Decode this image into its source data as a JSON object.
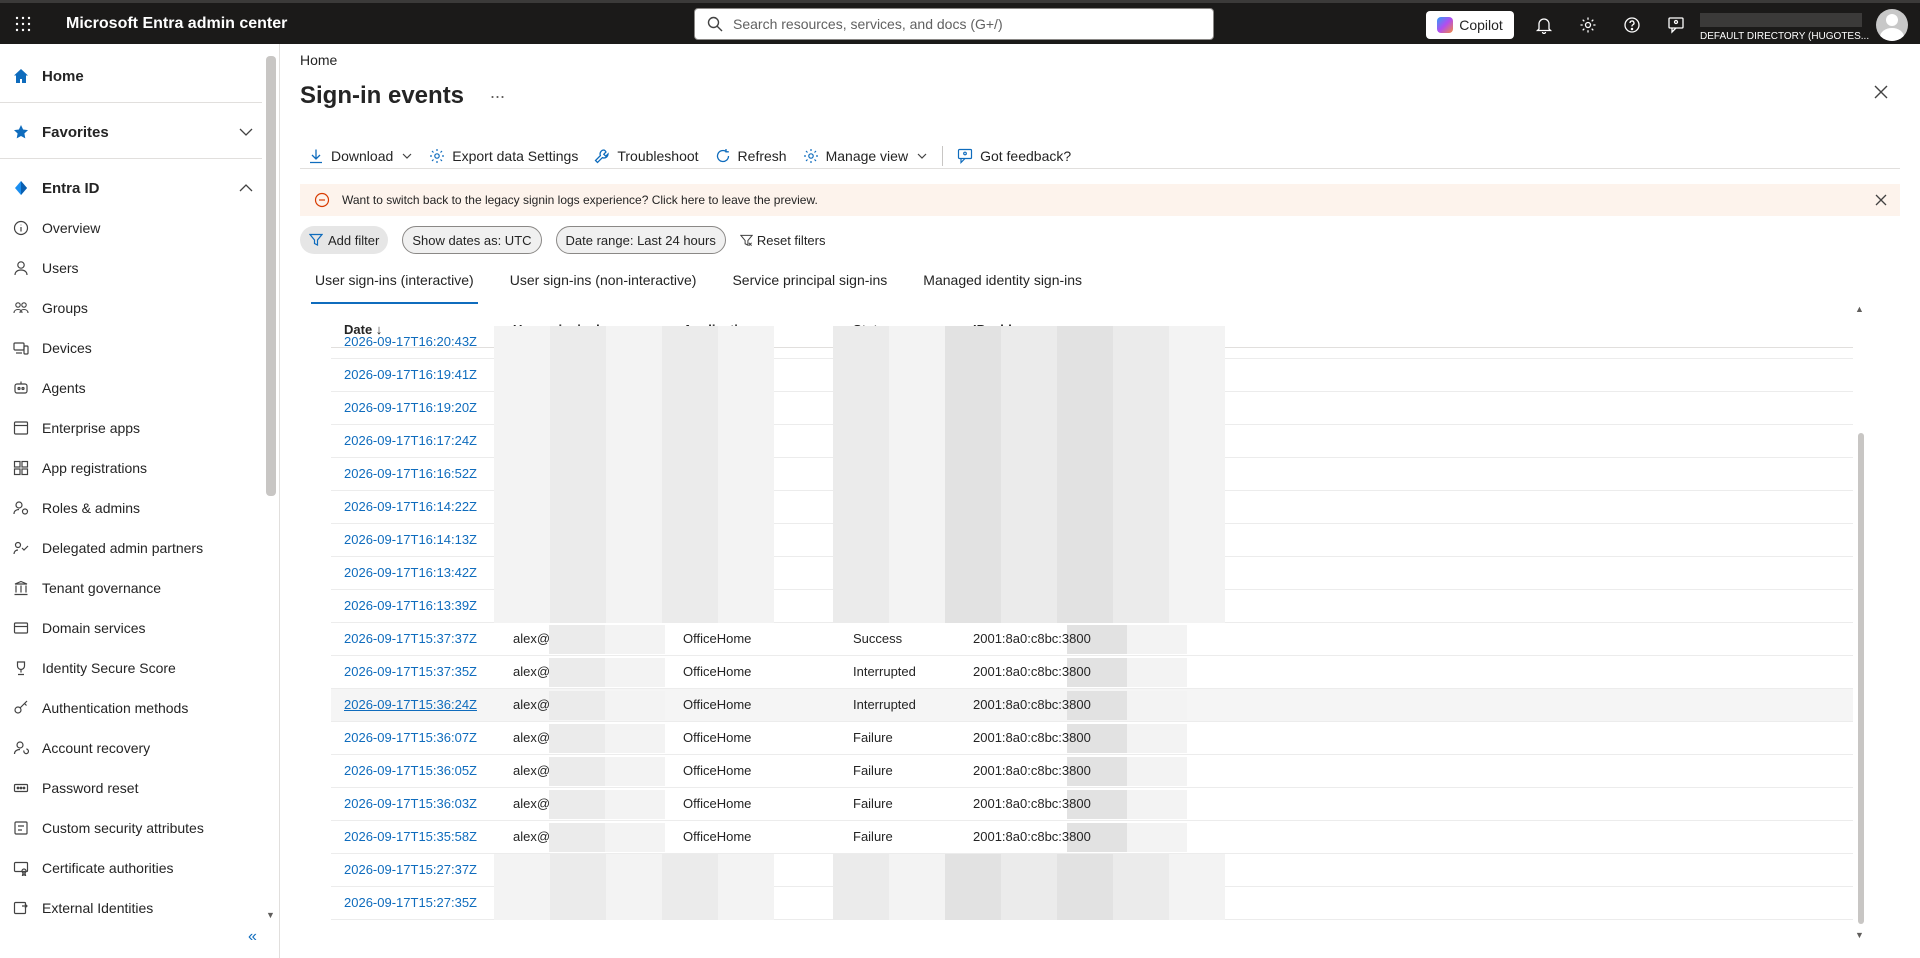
{
  "topbar": {
    "app_title": "Microsoft Entra admin center",
    "search_placeholder": "Search resources, services, and docs (G+/)",
    "copilot_label": "Copilot",
    "account_directory": "DEFAULT DIRECTORY (HUGOTES..."
  },
  "sidebar": {
    "home": "Home",
    "favorites": "Favorites",
    "entra_id": "Entra ID",
    "items": [
      "Overview",
      "Users",
      "Groups",
      "Devices",
      "Agents",
      "Enterprise apps",
      "App registrations",
      "Roles & admins",
      "Delegated admin partners",
      "Tenant governance",
      "Domain services",
      "Identity Secure Score",
      "Authentication methods",
      "Account recovery",
      "Password reset",
      "Custom security attributes",
      "Certificate authorities",
      "External Identities"
    ]
  },
  "main": {
    "breadcrumb": "Home",
    "title": "Sign-in events",
    "more": "...",
    "toolbar": {
      "download": "Download",
      "export": "Export data Settings",
      "troubleshoot": "Troubleshoot",
      "refresh": "Refresh",
      "manage_view": "Manage view",
      "feedback": "Got feedback?"
    },
    "banner": "Want to switch back to the legacy signin logs experience? Click here to leave the preview.",
    "filters": {
      "add_filter": "Add filter",
      "show_dates": "Show dates as: UTC",
      "date_range": "Date range: Last 24 hours",
      "reset": "Reset filters"
    },
    "tabs": [
      "User sign-ins (interactive)",
      "User sign-ins (non-interactive)",
      "Service principal sign-ins",
      "Managed identity sign-ins"
    ],
    "table": {
      "columns": [
        "Date ↓",
        "User principal name",
        "Application",
        "Status",
        "IP address"
      ],
      "rows": [
        {
          "date": "2026-09-17T16:20:43Z",
          "user": "",
          "app": "",
          "status": "",
          "ip": ""
        },
        {
          "date": "2026-09-17T16:19:41Z",
          "user": "",
          "app": "",
          "status": "",
          "ip": ""
        },
        {
          "date": "2026-09-17T16:19:20Z",
          "user": "",
          "app": "",
          "status": "",
          "ip": ""
        },
        {
          "date": "2026-09-17T16:17:24Z",
          "user": "",
          "app": "",
          "status": "",
          "ip": ""
        },
        {
          "date": "2026-09-17T16:16:52Z",
          "user": "",
          "app": "",
          "status": "",
          "ip": ""
        },
        {
          "date": "2026-09-17T16:14:22Z",
          "user": "",
          "app": "",
          "status": "",
          "ip": ""
        },
        {
          "date": "2026-09-17T16:14:13Z",
          "user": "",
          "app": "",
          "status": "",
          "ip": ""
        },
        {
          "date": "2026-09-17T16:13:42Z",
          "user": "",
          "app": "",
          "status": "",
          "ip": ""
        },
        {
          "date": "2026-09-17T16:13:39Z",
          "user": "",
          "app": "",
          "status": "",
          "ip": ""
        },
        {
          "date": "2026-09-17T15:37:37Z",
          "user": "alex@",
          "app": "OfficeHome",
          "status": "Success",
          "ip": "2001:8a0:c8bc:3800"
        },
        {
          "date": "2026-09-17T15:37:35Z",
          "user": "alex@",
          "app": "OfficeHome",
          "status": "Interrupted",
          "ip": "2001:8a0:c8bc:3800"
        },
        {
          "date": "2026-09-17T15:36:24Z",
          "user": "alex@",
          "app": "OfficeHome",
          "status": "Interrupted",
          "ip": "2001:8a0:c8bc:3800"
        },
        {
          "date": "2026-09-17T15:36:07Z",
          "user": "alex@",
          "app": "OfficeHome",
          "status": "Failure",
          "ip": "2001:8a0:c8bc:3800"
        },
        {
          "date": "2026-09-17T15:36:05Z",
          "user": "alex@",
          "app": "OfficeHome",
          "status": "Failure",
          "ip": "2001:8a0:c8bc:3800"
        },
        {
          "date": "2026-09-17T15:36:03Z",
          "user": "alex@",
          "app": "OfficeHome",
          "status": "Failure",
          "ip": "2001:8a0:c8bc:3800"
        },
        {
          "date": "2026-09-17T15:35:58Z",
          "user": "alex@",
          "app": "OfficeHome",
          "status": "Failure",
          "ip": "2001:8a0:c8bc:3800"
        },
        {
          "date": "2026-09-17T15:27:37Z",
          "user": "",
          "app": "",
          "status": "",
          "ip": ""
        },
        {
          "date": "2026-09-17T15:27:35Z",
          "user": "",
          "app": "",
          "status": "",
          "ip": ""
        }
      ]
    }
  },
  "colors": {
    "accent": "#0f6cbd",
    "topbar": "#1b1a19",
    "banner": "#fdf3ec"
  }
}
